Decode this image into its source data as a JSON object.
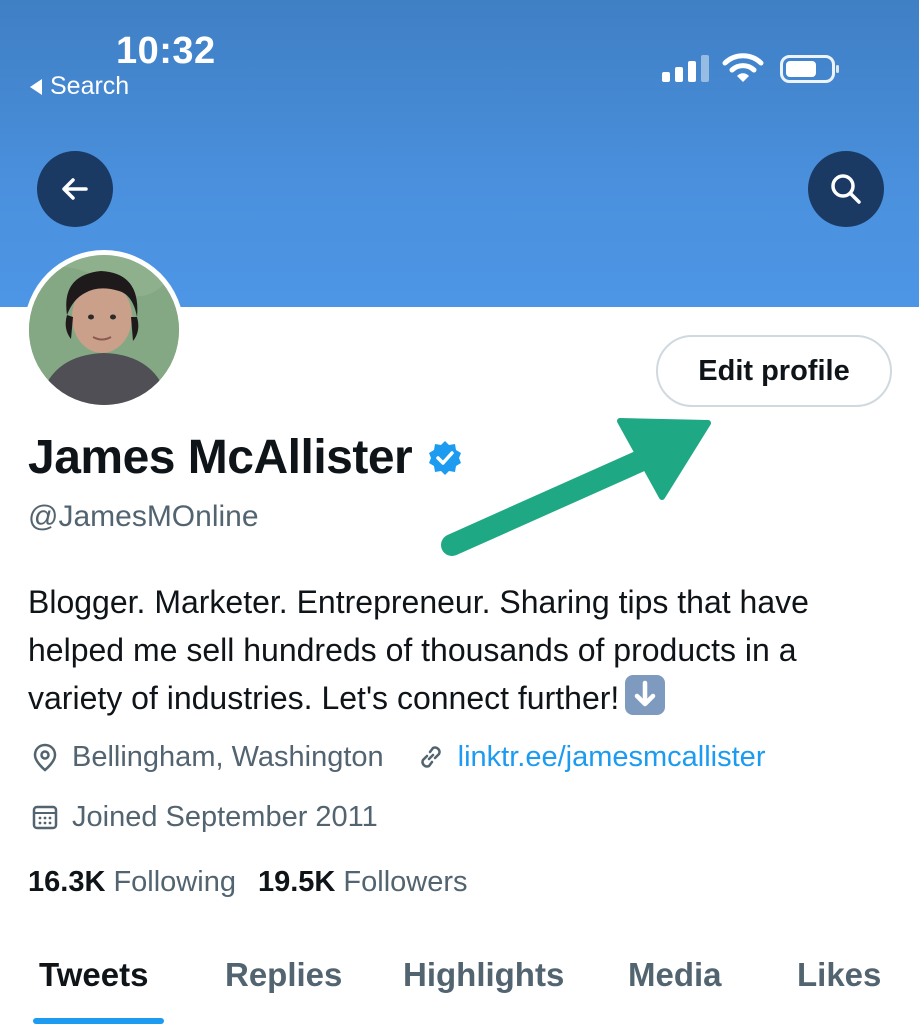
{
  "status_bar": {
    "time": "10:32",
    "back_label": "Search"
  },
  "colors": {
    "banner": "#4a90dd",
    "accent": "#1d9bf0",
    "arrow": "#1fa884",
    "nav_button": "#1b3a63"
  },
  "header": {
    "back_icon": "arrow-left-icon",
    "search_icon": "search-icon"
  },
  "profile": {
    "name": "James McAllister",
    "verified_icon": "verified-badge-icon",
    "handle": "@JamesMOnline",
    "edit_button_label": "Edit profile",
    "bio": "Blogger. Marketer. Entrepreneur. Sharing tips that have helped me sell hundreds of thousands of products in a variety of industries. Let's connect further!",
    "bio_emoji": "down-arrow-emoji",
    "location": "Bellingham, Washington",
    "link": "linktr.ee/jamesmcallister",
    "joined": "Joined September 2011",
    "following_count": "16.3K",
    "following_label": "Following",
    "followers_count": "19.5K",
    "followers_label": "Followers"
  },
  "tabs": [
    {
      "label": "Tweets",
      "active": true
    },
    {
      "label": "Replies",
      "active": false
    },
    {
      "label": "Highlights",
      "active": false
    },
    {
      "label": "Media",
      "active": false
    },
    {
      "label": "Likes",
      "active": false
    }
  ]
}
